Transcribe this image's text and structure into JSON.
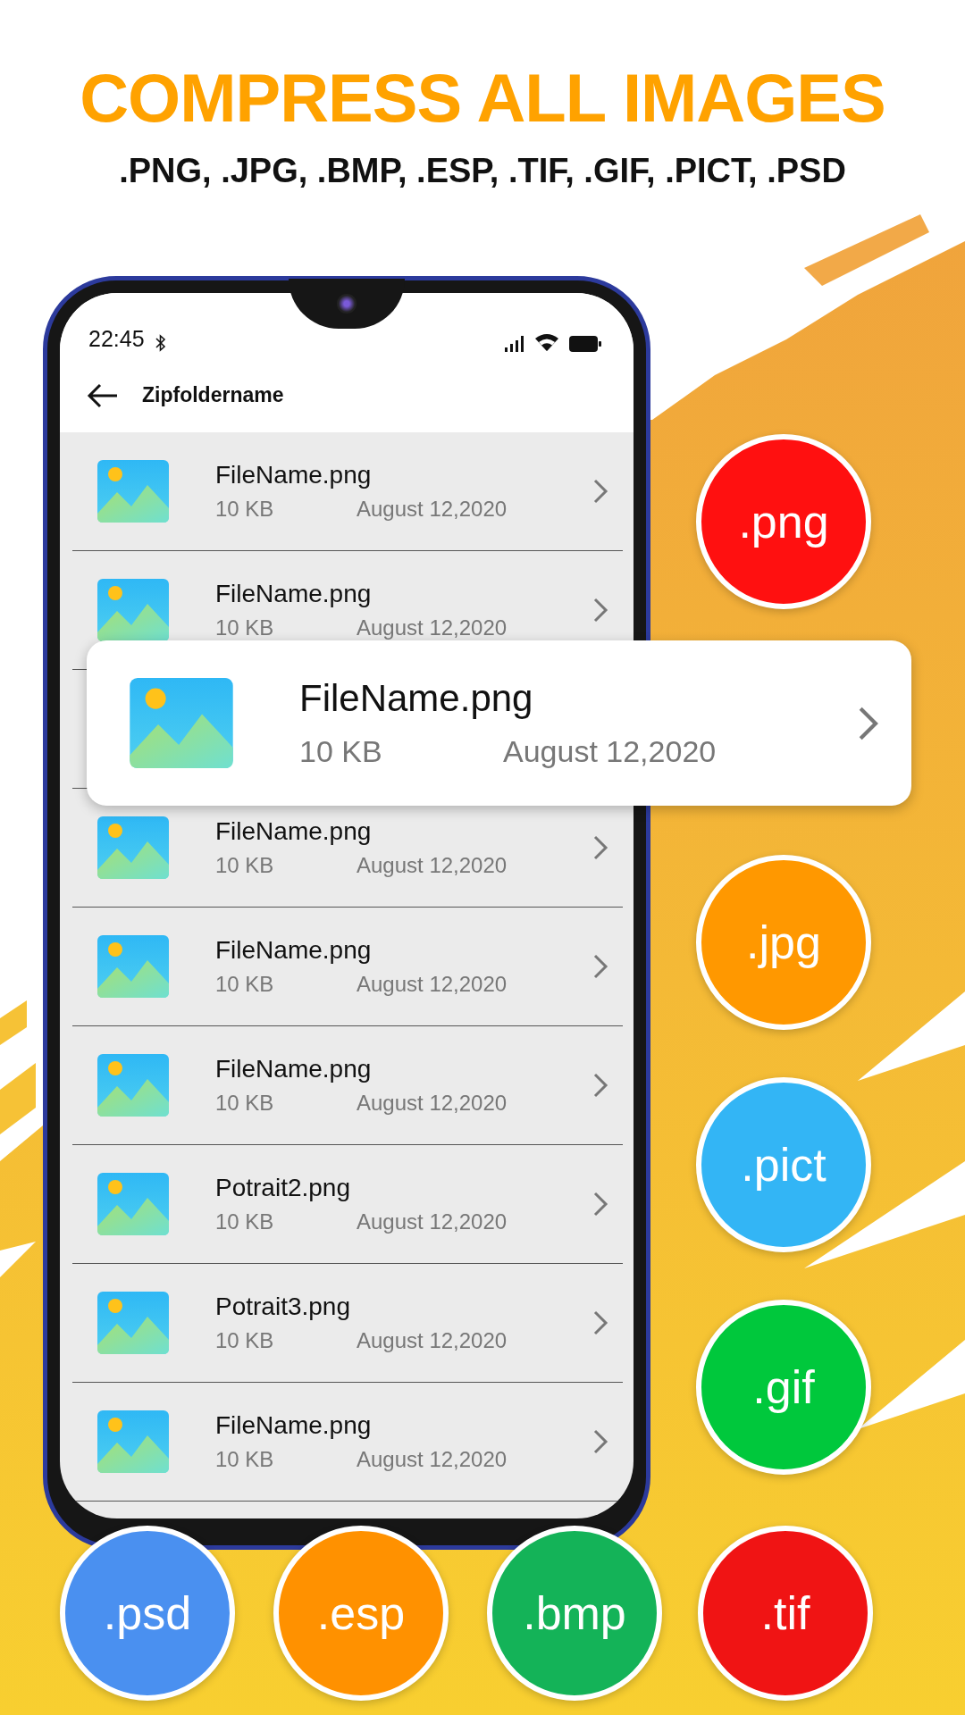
{
  "headline": {
    "title": "COMPRESS ALL IMAGES",
    "formats": ".PNG, .JPG, .BMP, .ESP, .TIF, .GIF, .PICT, .PSD"
  },
  "phone": {
    "status_bar": {
      "time": "22:45"
    },
    "header": {
      "title": "Zipfoldername"
    },
    "files": [
      {
        "name": "FileName.png",
        "size": "10 KB",
        "date": "August 12,2020"
      },
      {
        "name": "FileName.png",
        "size": "10 KB",
        "date": "August 12,2020"
      },
      {
        "name": "FileName.png",
        "size": "10 KB",
        "date": "August 12,2020"
      },
      {
        "name": "FileName.png",
        "size": "10 KB",
        "date": "August 12,2020"
      },
      {
        "name": "FileName.png",
        "size": "10 KB",
        "date": "August 12,2020"
      },
      {
        "name": "Potrait2.png",
        "size": "10 KB",
        "date": "August 12,2020"
      },
      {
        "name": "Potrait3.png",
        "size": "10 KB",
        "date": "August 12,2020"
      },
      {
        "name": "FileName.png",
        "size": "10 KB",
        "date": "August 12,2020"
      }
    ]
  },
  "highlighted_file": {
    "name": "FileName.png",
    "size": "10 KB",
    "date": "August 12,2020"
  },
  "format_badges": [
    {
      "label": ".png",
      "color": "#ff1010"
    },
    {
      "label": ".jpg",
      "color": "#ff9800"
    },
    {
      "label": ".pict",
      "color": "#33b5f5"
    },
    {
      "label": ".gif",
      "color": "#00c83c"
    },
    {
      "label": ".psd",
      "color": "#4a90f0"
    },
    {
      "label": ".esp",
      "color": "#ff9100"
    },
    {
      "label": ".bmp",
      "color": "#14b358"
    },
    {
      "label": ".tif",
      "color": "#f01414"
    }
  ]
}
